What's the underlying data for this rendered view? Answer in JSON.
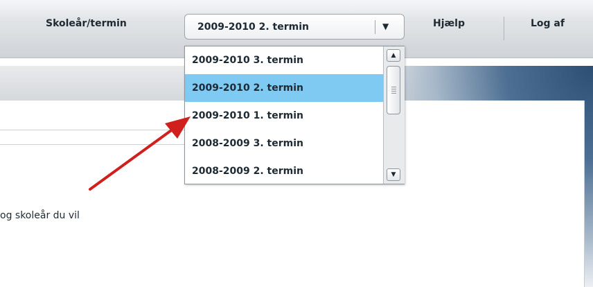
{
  "header": {
    "term_label": "Skoleår/termin",
    "selected_term": "2009-2010 2. termin",
    "help": "Hjælp",
    "logout": "Log af"
  },
  "dropdown": {
    "options": [
      "2009-2010 3. termin",
      "2009-2010 2. termin",
      "2009-2010 1. termin",
      "2008-2009 3. termin",
      "2008-2009 2. termin"
    ],
    "selected_index": 1
  },
  "content": {
    "hint_text": "og skoleår du vil"
  },
  "colors": {
    "selected_option": "#7fcaf2",
    "arrow": "#d0201d"
  }
}
